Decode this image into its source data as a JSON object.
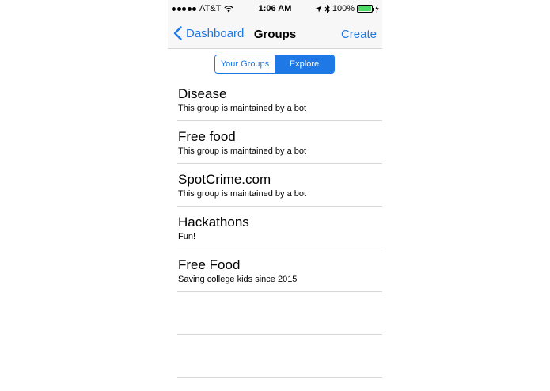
{
  "status_bar": {
    "carrier": "AT&T",
    "time": "1:06 AM",
    "battery_percent": "100%",
    "battery_level": 1.0,
    "icons": [
      "signal-dots",
      "wifi-icon",
      "location-arrow-icon",
      "bluetooth-icon",
      "battery-icon",
      "charging-bolt-icon"
    ]
  },
  "nav": {
    "back_label": "Dashboard",
    "title": "Groups",
    "action_label": "Create"
  },
  "segments": {
    "your_groups": "Your Groups",
    "explore": "Explore",
    "selected": "Explore"
  },
  "groups": [
    {
      "title": "Disease",
      "subtitle": "This group is maintained by a bot"
    },
    {
      "title": "Free food",
      "subtitle": "This group is maintained by a bot"
    },
    {
      "title": "SpotCrime.com",
      "subtitle": "This group is maintained by a bot"
    },
    {
      "title": "Hackathons",
      "subtitle": "Fun!"
    },
    {
      "title": "Free Food",
      "subtitle": "Saving college kids since 2015"
    }
  ],
  "colors": {
    "accent": "#1e78e6",
    "battery": "#4cd964",
    "separator": "#d7d7da"
  }
}
